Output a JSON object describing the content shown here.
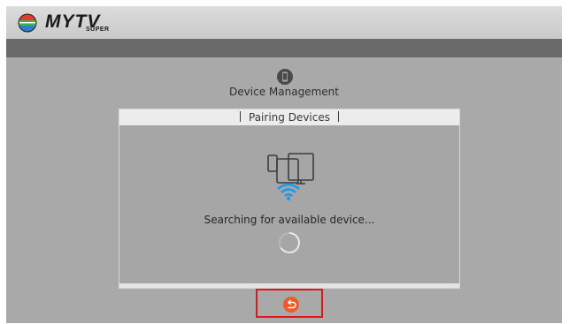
{
  "app": {
    "logo_text": "MYTV",
    "logo_subtext": "SUPER"
  },
  "page": {
    "icon": "phone-icon",
    "title": "Device Management"
  },
  "dialog": {
    "title": "Pairing Devices",
    "status_text": "Searching for available device...",
    "illustration": "devices-wifi-icon",
    "loading_indicator": "spinner-icon"
  },
  "footer": {
    "back_button_icon": "return-arrow-icon"
  },
  "colors": {
    "accent": "#ee5a2a",
    "wifi": "#1e9be8",
    "highlight_border": "#e0161b",
    "background": "#a9a9a9"
  }
}
